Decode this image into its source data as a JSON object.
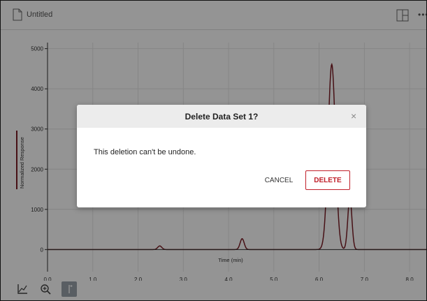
{
  "header": {
    "document_title": "Untitled",
    "more_icon": "ellipsis-icon"
  },
  "chart_data": {
    "type": "line",
    "xlabel": "Time (min)",
    "ylabel": "Normalized Response",
    "xlim": [
      0.0,
      8.4
    ],
    "ylim": [
      -550,
      5150
    ],
    "x_ticks": [
      "0.0",
      "1.0",
      "2.0",
      "3.0",
      "4.0",
      "5.0",
      "6.0",
      "7.0",
      "8.0"
    ],
    "y_ticks": [
      "0",
      "1000",
      "2000",
      "3000",
      "4000",
      "5000"
    ],
    "grid": true,
    "series": [
      {
        "color": "#7a1d25",
        "peaks": [
          {
            "x": 2.48,
            "height": 90
          },
          {
            "x": 4.3,
            "height": 270
          },
          {
            "x": 6.28,
            "height": 4610
          },
          {
            "x": 6.68,
            "height": 1300
          }
        ]
      }
    ]
  },
  "toolbar": {
    "icons": [
      "axes-icon",
      "zoom-icon",
      "marker-icon"
    ]
  },
  "dialog": {
    "title": "Delete Data Set 1?",
    "close_symbol": "×",
    "message": "This deletion can't be undone.",
    "cancel_label": "CANCEL",
    "delete_label": "DELETE"
  }
}
